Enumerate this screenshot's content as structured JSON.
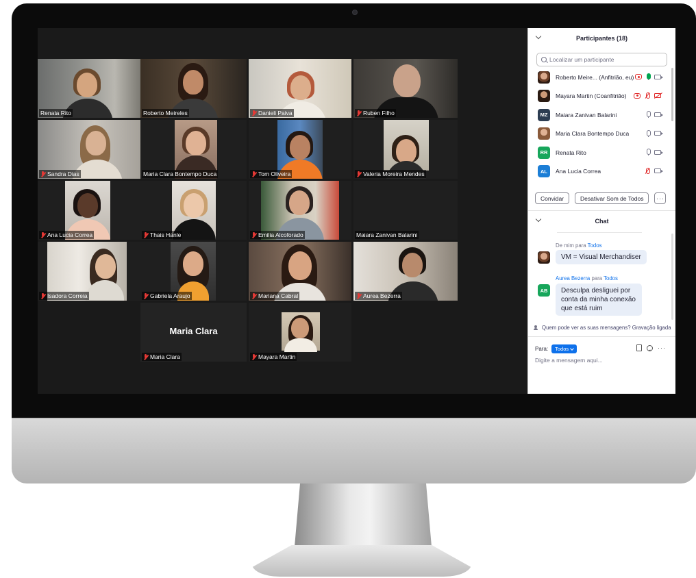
{
  "tiles": [
    {
      "name": "Renata Rito",
      "muted": false,
      "active": false
    },
    {
      "name": "Roberto Meireles",
      "muted": false,
      "active": true
    },
    {
      "name": "Danieli Paiva",
      "muted": true,
      "active": false
    },
    {
      "name": "Ruben Filho",
      "muted": true,
      "active": false
    },
    {
      "name": "Sandra Dias",
      "muted": true,
      "active": false
    },
    {
      "name": "Maria Clara Bontempo Duca",
      "muted": false,
      "active": false
    },
    {
      "name": "Tom Oliveira",
      "muted": true,
      "active": false
    },
    {
      "name": "Valeria Moreira Mendes",
      "muted": true,
      "active": false
    },
    {
      "name": "Ana Lucia Correa",
      "muted": true,
      "active": false
    },
    {
      "name": "Thais Hanle",
      "muted": true,
      "active": false
    },
    {
      "name": "Emilia Alcoforado",
      "muted": true,
      "active": false
    },
    {
      "name": "Maiara Zanivan Balarini",
      "muted": false,
      "active": false
    },
    {
      "name": "Isadora Correia",
      "muted": true,
      "active": false
    },
    {
      "name": "Gabriela Araujo",
      "muted": true,
      "active": false
    },
    {
      "name": "Mariana Cabral",
      "muted": true,
      "active": false
    },
    {
      "name": "Aurea Bezerra",
      "muted": true,
      "active": false
    },
    {
      "name": "Maria Clara",
      "muted": true,
      "active": false,
      "camera_off_label": "Maria Clara"
    },
    {
      "name": "Mayara Martin",
      "muted": true,
      "active": false
    }
  ],
  "participants_panel": {
    "title": "Participantes (18)",
    "search_placeholder": "Localizar um participante",
    "rows": [
      {
        "name": "Roberto Meire... (Anfitrião, eu)",
        "avatar": "photo",
        "recording": true,
        "mic": "live",
        "camera": "on"
      },
      {
        "name": "Mayara Martin (Coanfitrião)",
        "avatar": "photo",
        "recording": true,
        "mic": "muted",
        "camera": "off"
      },
      {
        "name": "Maiara Zanivan Balarini",
        "avatar": "MZ",
        "avatar_color": "#2d3d52",
        "mic": "on",
        "camera": "on"
      },
      {
        "name": "Maria Clara Bontempo Duca",
        "avatar": "photo",
        "mic": "on",
        "camera": "on"
      },
      {
        "name": "Renata Rito",
        "avatar": "RR",
        "avatar_color": "#17a65b",
        "mic": "on",
        "camera": "on"
      },
      {
        "name": "Ana Lucia Correa",
        "avatar": "AL",
        "avatar_color": "#1c7ed6",
        "mic": "muted",
        "camera": "on"
      }
    ],
    "invite_label": "Convidar",
    "mute_all_label": "Desativar Som de Todos",
    "more_label": "···"
  },
  "chat_panel": {
    "title": "Chat",
    "messages": [
      {
        "from": "De mim",
        "to_word": "para",
        "to": "Todos",
        "text": "VM = Visual Merchandiser",
        "avatar": "photo"
      },
      {
        "from": "Aurea Bezerra",
        "to_word": "para",
        "to": "Todos",
        "text": "Desculpa desliguei por conta da minha conexão que está ruim",
        "avatar": "AB",
        "avatar_color": "#17a65b"
      }
    ],
    "info_text": "Quem pode ver as suas mensagens? Gravação ligada",
    "to_label": "Para:",
    "to_value": "Todos",
    "input_placeholder": "Digite a mensagem aqui...",
    "more_label": "···"
  },
  "colors": {
    "active_speaker": "#cddc39",
    "muted_red": "#e53935",
    "zoom_blue": "#0e71eb",
    "screen_bg": "#1a1a1a"
  },
  "icons": [
    "search-icon",
    "mic-icon",
    "mic-muted-icon",
    "camera-icon",
    "camera-off-icon",
    "record-icon",
    "people-icon",
    "file-icon",
    "emoji-icon",
    "chevron-down-icon"
  ]
}
